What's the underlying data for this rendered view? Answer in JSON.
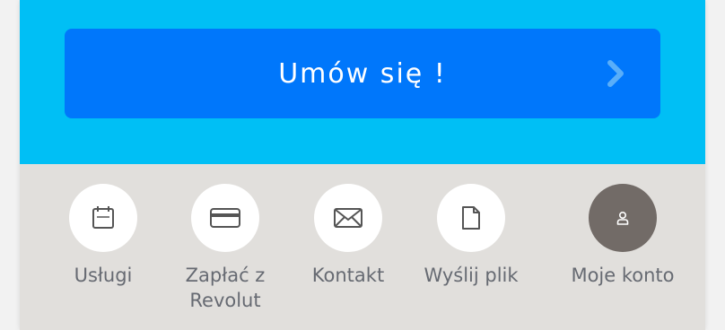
{
  "cta": {
    "label": "Umów się !"
  },
  "nav": [
    {
      "label": "Usługi",
      "icon": "calendar-icon"
    },
    {
      "label": "Zapłać z Revolut",
      "icon": "credit-card-icon"
    },
    {
      "label": "Kontakt",
      "icon": "envelope-icon"
    },
    {
      "label": "Wyślij plik",
      "icon": "file-icon"
    },
    {
      "label": "Moje konto",
      "icon": "user-icon"
    }
  ],
  "colors": {
    "top_bg": "#00bff5",
    "cta_bg": "#0077fb",
    "cta_chevron": "#59aef9",
    "bottom_bg": "#e1dfdc",
    "label_text": "#666a72",
    "account_circle": "#726b67"
  }
}
